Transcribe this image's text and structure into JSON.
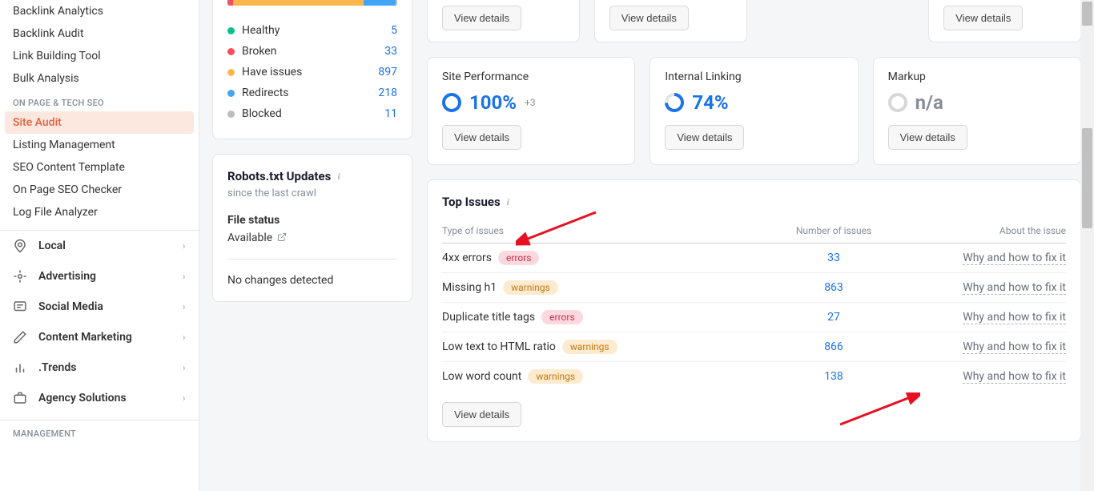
{
  "sidebar": {
    "items_top": [
      "Backlink Analytics",
      "Backlink Audit",
      "Link Building Tool",
      "Bulk Analysis"
    ],
    "section_onpage": "ON PAGE & TECH SEO",
    "items_onpage": [
      "Site Audit",
      "Listing Management",
      "SEO Content Template",
      "On Page SEO Checker",
      "Log File Analyzer"
    ],
    "categories": [
      "Local",
      "Advertising",
      "Social Media",
      "Content Marketing",
      ".Trends",
      "Agency Solutions"
    ],
    "section_mgmt": "MANAGEMENT"
  },
  "health": {
    "legend": [
      {
        "label": "Healthy",
        "value": "5",
        "color": "#00c48c"
      },
      {
        "label": "Broken",
        "value": "33",
        "color": "#ff4b5c"
      },
      {
        "label": "Have issues",
        "value": "897",
        "color": "#ffb74d"
      },
      {
        "label": "Redirects",
        "value": "218",
        "color": "#42a5f5"
      },
      {
        "label": "Blocked",
        "value": "11",
        "color": "#bdbdbd"
      }
    ]
  },
  "chart_data": {
    "type": "bar",
    "orientation": "stacked-horizontal",
    "categories": [
      "Healthy",
      "Broken",
      "Have issues",
      "Redirects",
      "Blocked"
    ],
    "values": [
      5,
      33,
      897,
      218,
      11
    ],
    "colors": [
      "#00c48c",
      "#ff4b5c",
      "#ffb74d",
      "#42a5f5",
      "#bdbdbd"
    ]
  },
  "robots": {
    "title": "Robots.txt Updates",
    "subtitle": "since the last crawl",
    "file_status_label": "File status",
    "file_status_value": "Available",
    "nochanges": "No changes detected"
  },
  "metrics_top_btn": "View details",
  "metrics": [
    {
      "title": "Site Performance",
      "value": "100%",
      "extra": "+3",
      "ring": "full",
      "btn": "View details"
    },
    {
      "title": "Internal Linking",
      "value": "74%",
      "extra": "",
      "ring": "74",
      "btn": "View details"
    },
    {
      "title": "Markup",
      "value": "n/a",
      "extra": "",
      "ring": "gray",
      "btn": "View details"
    }
  ],
  "top_issues": {
    "title": "Top Issues",
    "headers": {
      "type": "Type of issues",
      "num": "Number of issues",
      "about": "About the issue"
    },
    "rows": [
      {
        "name": "4xx errors",
        "tag": "errors",
        "num": "33",
        "about": "Why and how to fix it"
      },
      {
        "name": "Missing h1",
        "tag": "warnings",
        "num": "863",
        "about": "Why and how to fix it"
      },
      {
        "name": "Duplicate title tags",
        "tag": "errors",
        "num": "27",
        "about": "Why and how to fix it"
      },
      {
        "name": "Low text to HTML ratio",
        "tag": "warnings",
        "num": "866",
        "about": "Why and how to fix it"
      },
      {
        "name": "Low word count",
        "tag": "warnings",
        "num": "138",
        "about": "Why and how to fix it"
      }
    ],
    "btn": "View details"
  }
}
